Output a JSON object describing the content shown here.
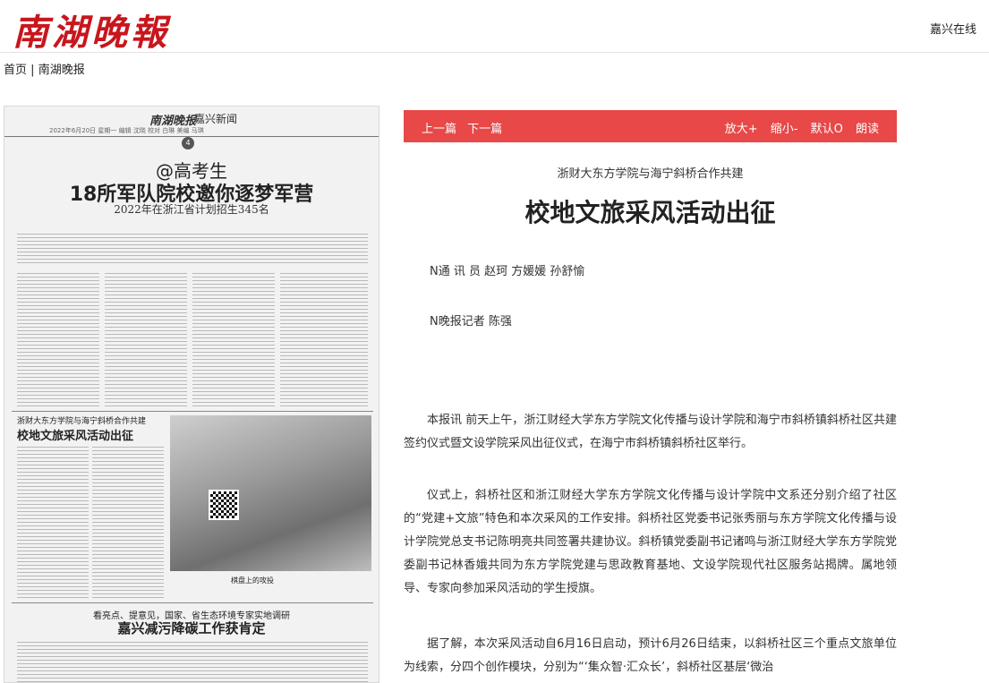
{
  "header": {
    "logo_text": "南湖晚報",
    "site_name": "嘉兴在线"
  },
  "breadcrumb": {
    "home": "首页",
    "separator": "|",
    "section": "南湖晚报"
  },
  "newspaper_page": {
    "masthead": "南湖晚报",
    "section_name": "嘉兴新闻",
    "meta_line": "2022年6月20日 星期一 编辑 沈晓 校对 白琳 美编 马琪",
    "page_number": "4",
    "headline_1": "@高考生",
    "headline_2": "18所军队院校邀你逐梦军营",
    "headline_3": "2022年在浙江省计划招生345名",
    "article_kicker": "浙财大东方学院与海宁斜桥合作共建",
    "article_headline": "校地文旅采风活动出征",
    "photo_caption": "棋盘上的攻投",
    "bottom_kicker": "看亮点、提意见，国家、省生态环境专家实地调研",
    "bottom_headline": "嘉兴减污降碳工作获肯定"
  },
  "toolbar": {
    "prev": "上一篇",
    "next": "下一篇",
    "zoom_in": "放大+",
    "zoom_out": "缩小-",
    "default": "默认O",
    "read_aloud": "朗读"
  },
  "article": {
    "kicker": "浙财大东方学院与海宁斜桥合作共建",
    "title": "校地文旅采风活动出征",
    "byline_1": "N通 讯 员 赵珂 方媛媛 孙舒愉",
    "byline_2": "N晚报记者 陈强",
    "paragraphs": [
      "本报讯 前天上午，浙江财经大学东方学院文化传播与设计学院和海宁市斜桥镇斜桥社区共建签约仪式暨文设学院采风出征仪式，在海宁市斜桥镇斜桥社区举行。",
      "仪式上，斜桥社区和浙江财经大学东方学院文化传播与设计学院中文系还分别介绍了社区的“党建+文旅”特色和本次采风的工作安排。斜桥社区党委书记张秀丽与东方学院文化传播与设计学院党总支书记陈明亮共同签署共建协议。斜桥镇党委副书记诸鸣与浙江财经大学东方学院党委副书记林香娥共同为东方学院党建与思政教育基地、文设学院现代社区服务站揭牌。属地领导、专家向参加采风活动的学生授旗。",
      "据了解，本次采风活动自6月16日启动，预计6月26日结束，以斜桥社区三个重点文旅单位为线索，分四个创作模块，分别为“‘集众智·汇众长’，斜桥社区基层‘微治"
    ]
  }
}
